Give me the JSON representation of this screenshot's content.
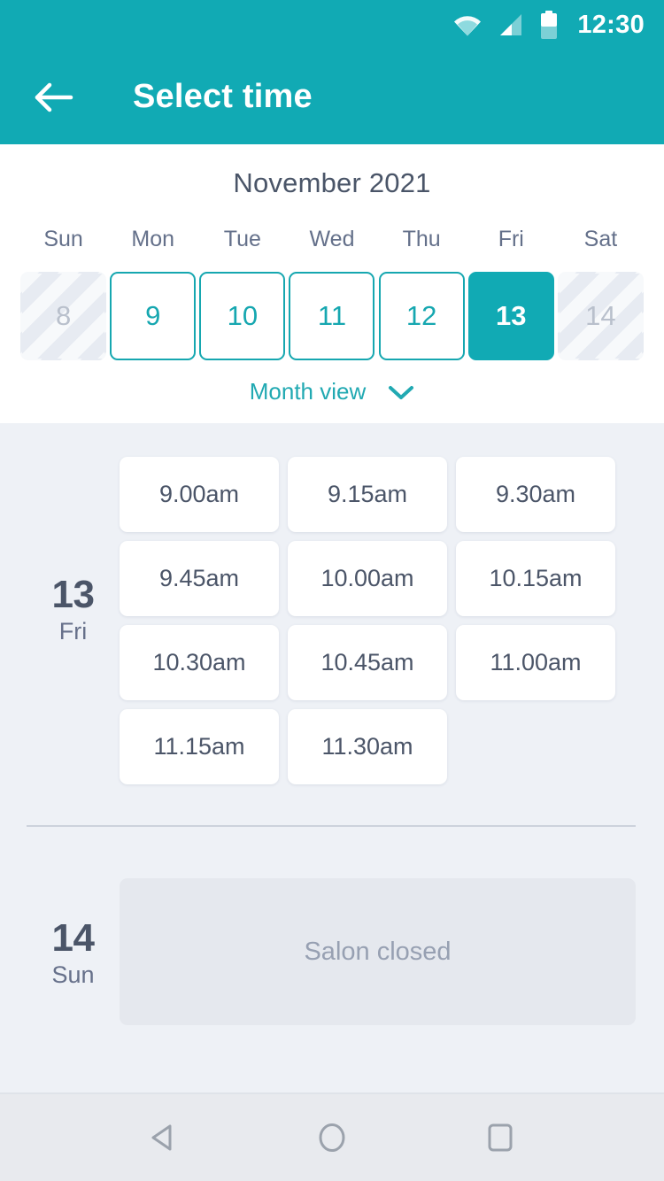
{
  "status_bar": {
    "time": "12:30",
    "icons": [
      "wifi-icon",
      "signal-icon",
      "battery-icon"
    ]
  },
  "app_bar": {
    "back_icon": "arrow-left-icon",
    "title": "Select time"
  },
  "calendar": {
    "month_title": "November 2021",
    "day_of_week_headers": [
      "Sun",
      "Mon",
      "Tue",
      "Wed",
      "Thu",
      "Fri",
      "Sat"
    ],
    "days": [
      {
        "number": "8",
        "state": "disabled"
      },
      {
        "number": "9",
        "state": "enabled"
      },
      {
        "number": "10",
        "state": "enabled"
      },
      {
        "number": "11",
        "state": "enabled"
      },
      {
        "number": "12",
        "state": "enabled"
      },
      {
        "number": "13",
        "state": "selected"
      },
      {
        "number": "14",
        "state": "disabled"
      }
    ],
    "month_view_label": "Month view",
    "month_view_icon": "chevron-down-icon"
  },
  "schedule": [
    {
      "day_number": "13",
      "day_name": "Fri",
      "slots": [
        "9.00am",
        "9.15am",
        "9.30am",
        "9.45am",
        "10.00am",
        "10.15am",
        "10.30am",
        "10.45am",
        "11.00am",
        "11.15am",
        "11.30am"
      ]
    },
    {
      "day_number": "14",
      "day_name": "Sun",
      "closed_message": "Salon closed"
    }
  ],
  "nav_bar": {
    "back_icon": "triangle-back-icon",
    "home_icon": "circle-home-icon",
    "recents_icon": "square-recents-icon"
  },
  "colors": {
    "accent_teal": "#11aab4",
    "page_background": "#eef1f6",
    "card_white": "#ffffff",
    "text_slate": "#4b5568",
    "text_muted": "#97a0b2",
    "disabled_grey": "#b9c0cc"
  }
}
